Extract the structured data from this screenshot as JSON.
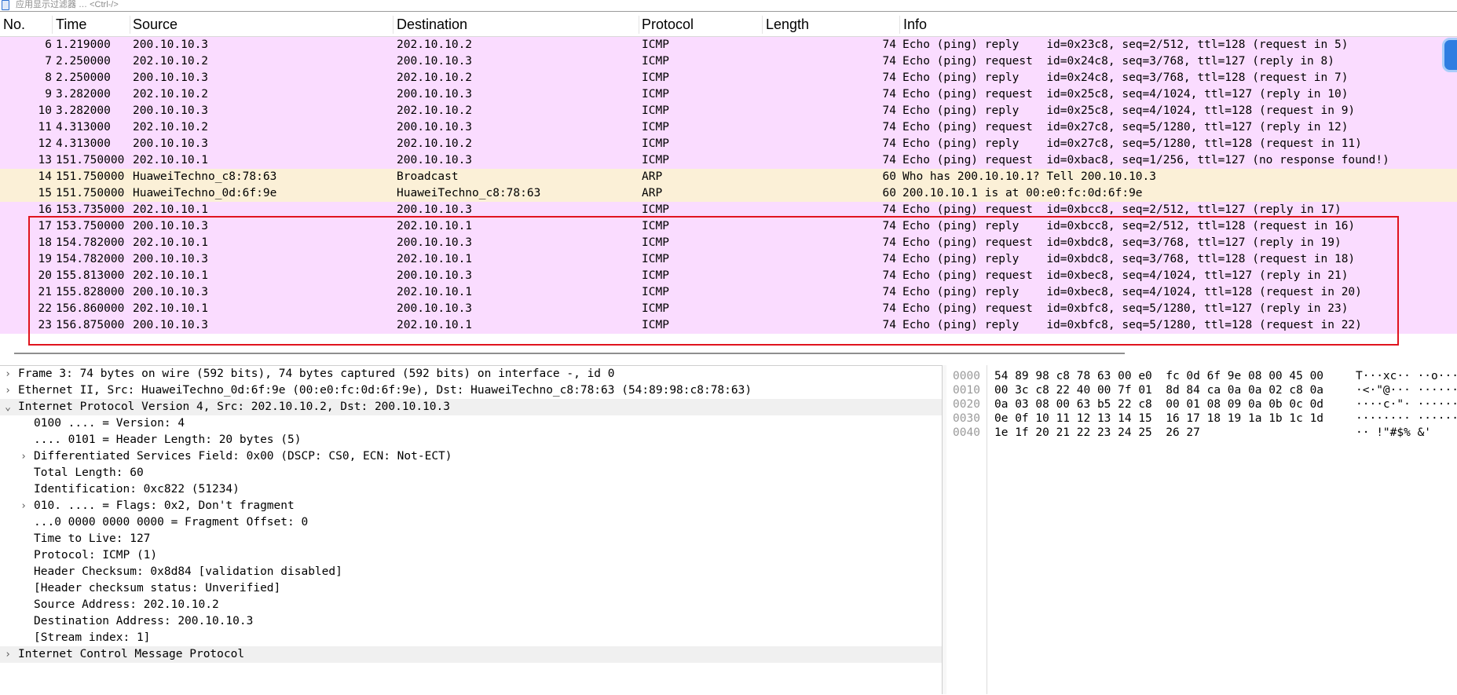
{
  "filter": {
    "placeholder": "应用显示过滤器 … <Ctrl-/>"
  },
  "columns": {
    "no": "No.",
    "time": "Time",
    "source": "Source",
    "destination": "Destination",
    "protocol": "Protocol",
    "length": "Length",
    "info": "Info"
  },
  "colors": {
    "icmp_row": "#fadcff",
    "arp_row": "#fbf0d7",
    "highlight_box": "#e0141e"
  },
  "packets": [
    {
      "no": "6",
      "time": "1.219000",
      "src": "200.10.10.3",
      "dst": "202.10.10.2",
      "proto": "ICMP",
      "len": "74",
      "info": "Echo (ping) reply    id=0x23c8, seq=2/512, ttl=128 (request in 5)",
      "kind": "icmp"
    },
    {
      "no": "7",
      "time": "2.250000",
      "src": "202.10.10.2",
      "dst": "200.10.10.3",
      "proto": "ICMP",
      "len": "74",
      "info": "Echo (ping) request  id=0x24c8, seq=3/768, ttl=127 (reply in 8)",
      "kind": "icmp"
    },
    {
      "no": "8",
      "time": "2.250000",
      "src": "200.10.10.3",
      "dst": "202.10.10.2",
      "proto": "ICMP",
      "len": "74",
      "info": "Echo (ping) reply    id=0x24c8, seq=3/768, ttl=128 (request in 7)",
      "kind": "icmp"
    },
    {
      "no": "9",
      "time": "3.282000",
      "src": "202.10.10.2",
      "dst": "200.10.10.3",
      "proto": "ICMP",
      "len": "74",
      "info": "Echo (ping) request  id=0x25c8, seq=4/1024, ttl=127 (reply in 10)",
      "kind": "icmp"
    },
    {
      "no": "10",
      "time": "3.282000",
      "src": "200.10.10.3",
      "dst": "202.10.10.2",
      "proto": "ICMP",
      "len": "74",
      "info": "Echo (ping) reply    id=0x25c8, seq=4/1024, ttl=128 (request in 9)",
      "kind": "icmp"
    },
    {
      "no": "11",
      "time": "4.313000",
      "src": "202.10.10.2",
      "dst": "200.10.10.3",
      "proto": "ICMP",
      "len": "74",
      "info": "Echo (ping) request  id=0x27c8, seq=5/1280, ttl=127 (reply in 12)",
      "kind": "icmp"
    },
    {
      "no": "12",
      "time": "4.313000",
      "src": "200.10.10.3",
      "dst": "202.10.10.2",
      "proto": "ICMP",
      "len": "74",
      "info": "Echo (ping) reply    id=0x27c8, seq=5/1280, ttl=128 (request in 11)",
      "kind": "icmp"
    },
    {
      "no": "13",
      "time": "151.750000",
      "src": "202.10.10.1",
      "dst": "200.10.10.3",
      "proto": "ICMP",
      "len": "74",
      "info": "Echo (ping) request  id=0xbac8, seq=1/256, ttl=127 (no response found!)",
      "kind": "icmp"
    },
    {
      "no": "14",
      "time": "151.750000",
      "src": "HuaweiTechno_c8:78:63",
      "dst": "Broadcast",
      "proto": "ARP",
      "len": "60",
      "info": "Who has 200.10.10.1? Tell 200.10.10.3",
      "kind": "arp"
    },
    {
      "no": "15",
      "time": "151.750000",
      "src": "HuaweiTechno_0d:6f:9e",
      "dst": "HuaweiTechno_c8:78:63",
      "proto": "ARP",
      "len": "60",
      "info": "200.10.10.1 is at 00:e0:fc:0d:6f:9e",
      "kind": "arp"
    },
    {
      "no": "16",
      "time": "153.735000",
      "src": "202.10.10.1",
      "dst": "200.10.10.3",
      "proto": "ICMP",
      "len": "74",
      "info": "Echo (ping) request  id=0xbcc8, seq=2/512, ttl=127 (reply in 17)",
      "kind": "icmp"
    },
    {
      "no": "17",
      "time": "153.750000",
      "src": "200.10.10.3",
      "dst": "202.10.10.1",
      "proto": "ICMP",
      "len": "74",
      "info": "Echo (ping) reply    id=0xbcc8, seq=2/512, ttl=128 (request in 16)",
      "kind": "icmp"
    },
    {
      "no": "18",
      "time": "154.782000",
      "src": "202.10.10.1",
      "dst": "200.10.10.3",
      "proto": "ICMP",
      "len": "74",
      "info": "Echo (ping) request  id=0xbdc8, seq=3/768, ttl=127 (reply in 19)",
      "kind": "icmp"
    },
    {
      "no": "19",
      "time": "154.782000",
      "src": "200.10.10.3",
      "dst": "202.10.10.1",
      "proto": "ICMP",
      "len": "74",
      "info": "Echo (ping) reply    id=0xbdc8, seq=3/768, ttl=128 (request in 18)",
      "kind": "icmp"
    },
    {
      "no": "20",
      "time": "155.813000",
      "src": "202.10.10.1",
      "dst": "200.10.10.3",
      "proto": "ICMP",
      "len": "74",
      "info": "Echo (ping) request  id=0xbec8, seq=4/1024, ttl=127 (reply in 21)",
      "kind": "icmp"
    },
    {
      "no": "21",
      "time": "155.828000",
      "src": "200.10.10.3",
      "dst": "202.10.10.1",
      "proto": "ICMP",
      "len": "74",
      "info": "Echo (ping) reply    id=0xbec8, seq=4/1024, ttl=128 (request in 20)",
      "kind": "icmp"
    },
    {
      "no": "22",
      "time": "156.860000",
      "src": "202.10.10.1",
      "dst": "200.10.10.3",
      "proto": "ICMP",
      "len": "74",
      "info": "Echo (ping) request  id=0xbfc8, seq=5/1280, ttl=127 (reply in 23)",
      "kind": "icmp"
    },
    {
      "no": "23",
      "time": "156.875000",
      "src": "200.10.10.3",
      "dst": "202.10.10.1",
      "proto": "ICMP",
      "len": "74",
      "info": "Echo (ping) reply    id=0xbfc8, seq=5/1280, ttl=128 (request in 22)",
      "kind": "icmp"
    }
  ],
  "details": [
    {
      "level": 0,
      "arrow": "›",
      "text": "Frame 3: 74 bytes on wire (592 bits), 74 bytes captured (592 bits) on interface -, id 0",
      "hl": false
    },
    {
      "level": 0,
      "arrow": "›",
      "text": "Ethernet II, Src: HuaweiTechno_0d:6f:9e (00:e0:fc:0d:6f:9e), Dst: HuaweiTechno_c8:78:63 (54:89:98:c8:78:63)",
      "hl": false
    },
    {
      "level": 0,
      "arrow": "⌄",
      "text": "Internet Protocol Version 4, Src: 202.10.10.2, Dst: 200.10.10.3",
      "hl": true
    },
    {
      "level": 1,
      "arrow": "",
      "text": "0100 .... = Version: 4",
      "hl": false
    },
    {
      "level": 1,
      "arrow": "",
      "text": ".... 0101 = Header Length: 20 bytes (5)",
      "hl": false
    },
    {
      "level": 1,
      "arrow": "›",
      "text": "Differentiated Services Field: 0x00 (DSCP: CS0, ECN: Not-ECT)",
      "hl": false
    },
    {
      "level": 1,
      "arrow": "",
      "text": "Total Length: 60",
      "hl": false
    },
    {
      "level": 1,
      "arrow": "",
      "text": "Identification: 0xc822 (51234)",
      "hl": false
    },
    {
      "level": 1,
      "arrow": "›",
      "text": "010. .... = Flags: 0x2, Don't fragment",
      "hl": false
    },
    {
      "level": 1,
      "arrow": "",
      "text": "...0 0000 0000 0000 = Fragment Offset: 0",
      "hl": false
    },
    {
      "level": 1,
      "arrow": "",
      "text": "Time to Live: 127",
      "hl": false
    },
    {
      "level": 1,
      "arrow": "",
      "text": "Protocol: ICMP (1)",
      "hl": false
    },
    {
      "level": 1,
      "arrow": "",
      "text": "Header Checksum: 0x8d84 [validation disabled]",
      "hl": false
    },
    {
      "level": 1,
      "arrow": "",
      "text": "[Header checksum status: Unverified]",
      "hl": false
    },
    {
      "level": 1,
      "arrow": "",
      "text": "Source Address: 202.10.10.2",
      "hl": false
    },
    {
      "level": 1,
      "arrow": "",
      "text": "Destination Address: 200.10.10.3",
      "hl": false
    },
    {
      "level": 1,
      "arrow": "",
      "text": "[Stream index: 1]",
      "hl": false
    },
    {
      "level": 0,
      "arrow": "›",
      "text": "Internet Control Message Protocol",
      "hl": true
    }
  ],
  "bytes": [
    {
      "off": "0000",
      "hex": "54 89 98 c8 78 63 00 e0  fc 0d 6f 9e 08 00 45 00",
      "asc": "T···xc·· ··o···E·"
    },
    {
      "off": "0010",
      "hex": "00 3c c8 22 40 00 7f 01  8d 84 ca 0a 0a 02 c8 0a",
      "asc": "·<·\"@··· ········"
    },
    {
      "off": "0020",
      "hex": "0a 03 08 00 63 b5 22 c8  00 01 08 09 0a 0b 0c 0d",
      "asc": "····c·\"· ········"
    },
    {
      "off": "0030",
      "hex": "0e 0f 10 11 12 13 14 15  16 17 18 19 1a 1b 1c 1d",
      "asc": "········ ········"
    },
    {
      "off": "0040",
      "hex": "1e 1f 20 21 22 23 24 25  26 27",
      "asc": "·· !\"#$% &'"
    }
  ]
}
